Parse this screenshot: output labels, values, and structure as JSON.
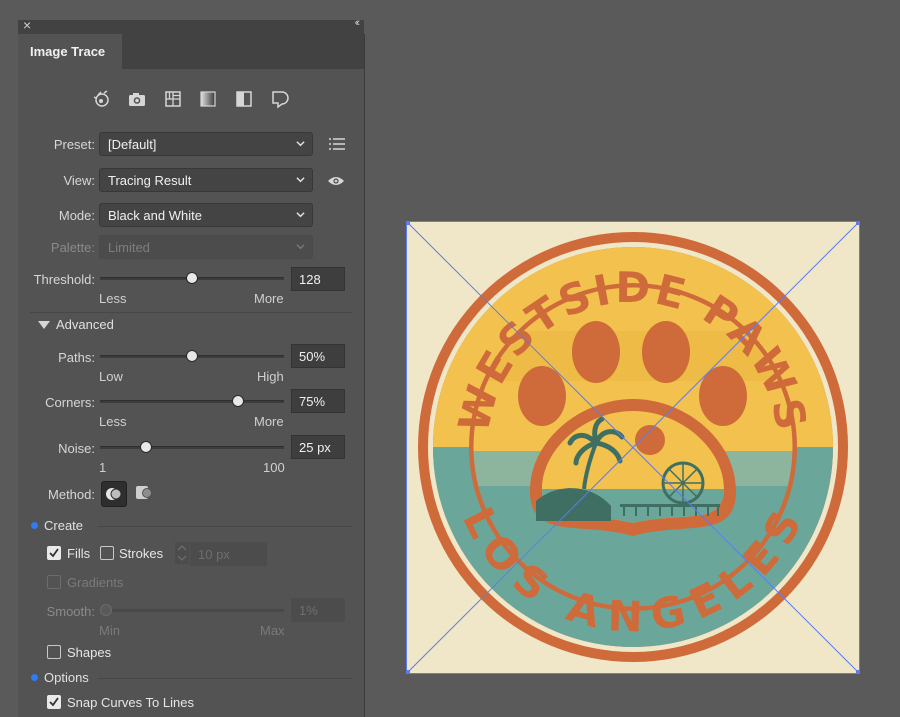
{
  "panel": {
    "title": "Image Trace",
    "close_glyph": "×",
    "collapse_glyph": "‹‹",
    "toolbar_icons": [
      "auto-color-icon",
      "high-color-icon",
      "low-color-icon",
      "grayscale-icon",
      "black-and-white-icon",
      "outline-icon"
    ],
    "preset": {
      "label": "Preset:",
      "value": "[Default]"
    },
    "view": {
      "label": "View:",
      "value": "Tracing Result"
    },
    "mode": {
      "label": "Mode:",
      "value": "Black and White"
    },
    "palette": {
      "label": "Palette:",
      "value": "Limited"
    },
    "threshold": {
      "label": "Threshold:",
      "value": "128",
      "level": 0.5,
      "min_label": "Less",
      "max_label": "More"
    },
    "advanced_label": "Advanced",
    "paths": {
      "label": "Paths:",
      "value": "50%",
      "level": 0.5,
      "min_label": "Low",
      "max_label": "High"
    },
    "corners": {
      "label": "Corners:",
      "value": "75%",
      "level": 0.75,
      "min_label": "Less",
      "max_label": "More"
    },
    "noise": {
      "label": "Noise:",
      "value": "25 px",
      "level": 0.25,
      "min_label": "1",
      "max_label": "100"
    },
    "method": {
      "label": "Method:"
    },
    "create": {
      "label": "Create",
      "fills": {
        "label": "Fills",
        "checked": true
      },
      "strokes": {
        "label": "Strokes",
        "checked": false,
        "value": "10 px"
      },
      "gradients": {
        "label": "Gradients",
        "checked": false
      }
    },
    "smooth": {
      "label": "Smooth:",
      "value": "1%",
      "level": 0,
      "min_label": "Min",
      "max_label": "Max"
    },
    "shapes": {
      "label": "Shapes",
      "checked": false
    },
    "options": {
      "label": "Options",
      "snap": {
        "label": "Snap Curves To Lines",
        "checked": true
      }
    },
    "accent_color": "#2f7bf5"
  },
  "artwork": {
    "top_text": "WESTSIDE PAWS",
    "bottom_text": "LOS ANGELES",
    "colors": {
      "background": "#f0e6c8",
      "orange": "#cf6b3a",
      "yellow": "#f2c14e",
      "teal": "#6aa79a",
      "bounding_box": "#5a7cf0"
    }
  }
}
